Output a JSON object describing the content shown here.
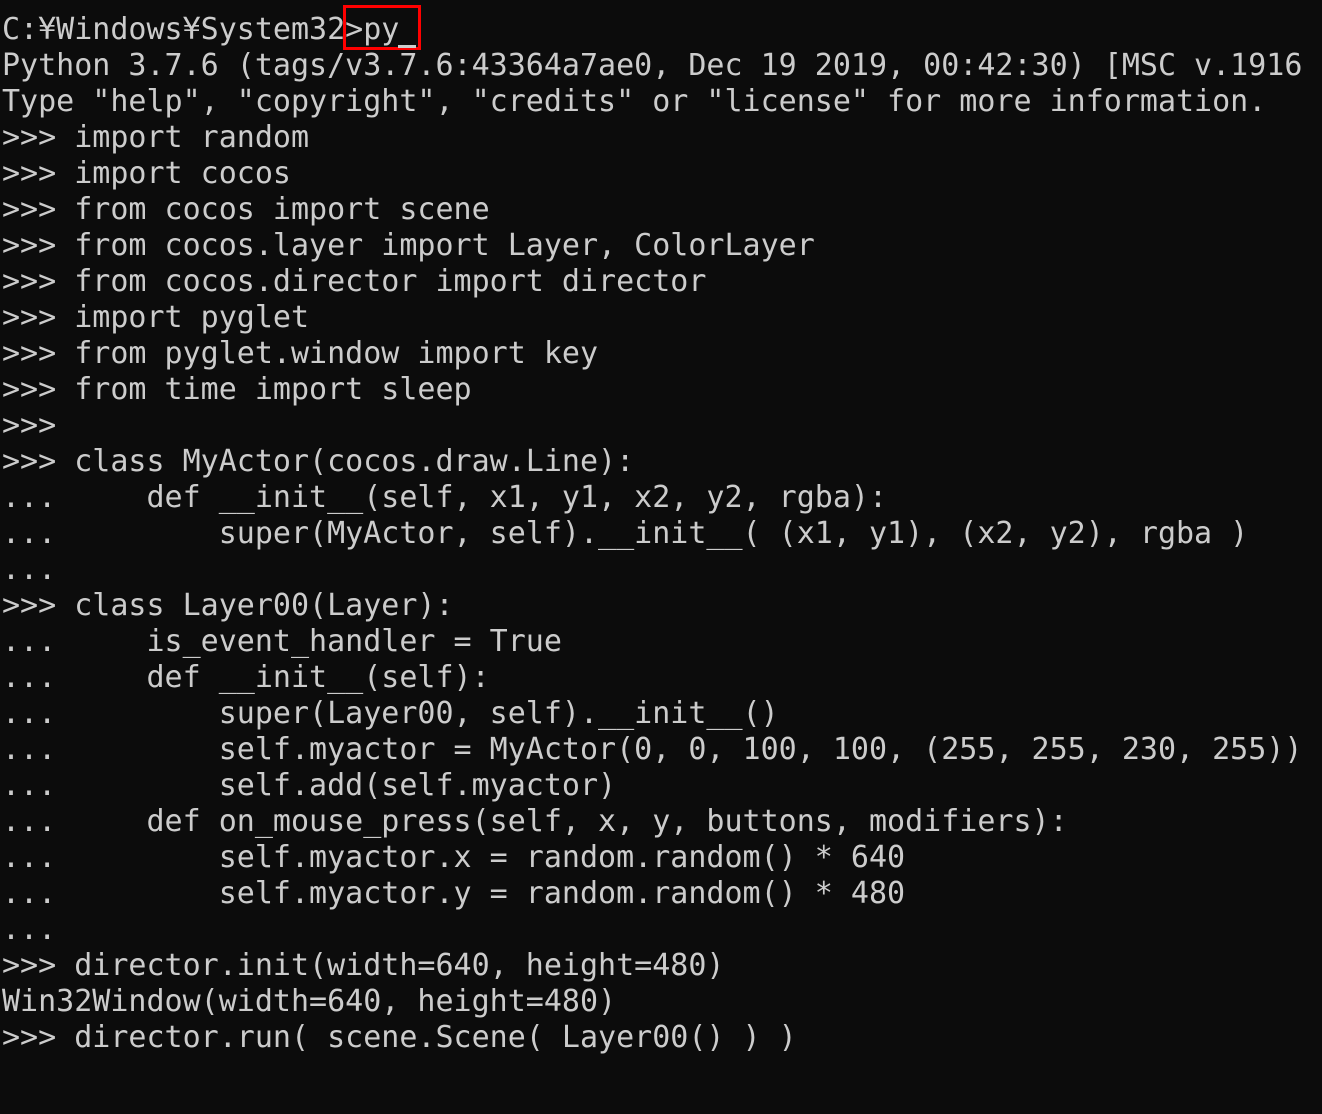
{
  "console": {
    "lines": [
      "C:¥Windows¥System32>py",
      "Python 3.7.6 (tags/v3.7.6:43364a7ae0, Dec 19 2019, 00:42:30) [MSC v.1916 (",
      "Type \"help\", \"copyright\", \"credits\" or \"license\" for more information.",
      ">>> import random",
      ">>> import cocos",
      ">>> from cocos import scene",
      ">>> from cocos.layer import Layer, ColorLayer",
      ">>> from cocos.director import director",
      ">>> import pyglet",
      ">>> from pyglet.window import key",
      ">>> from time import sleep",
      ">>>",
      ">>> class MyActor(cocos.draw.Line):",
      "...     def __init__(self, x1, y1, x2, y2, rgba):",
      "...         super(MyActor, self).__init__( (x1, y1), (x2, y2), rgba )",
      "...",
      ">>> class Layer00(Layer):",
      "...     is_event_handler = True",
      "...     def __init__(self):",
      "...         super(Layer00, self).__init__()",
      "...         self.myactor = MyActor(0, 0, 100, 100, (255, 255, 230, 255))",
      "...         self.add(self.myactor)",
      "...     def on_mouse_press(self, x, y, buttons, modifiers):",
      "...         self.myactor.x = random.random() * 640",
      "...         self.myactor.y = random.random() * 480",
      "...",
      ">>> director.init(width=640, height=480)",
      "Win32Window(width=640, height=480)",
      ">>> director.run( scene.Scene( Layer00() ) )"
    ]
  },
  "colors": {
    "background": "#0c0c0c",
    "text": "#cccccc",
    "highlight": "#ff0000"
  }
}
